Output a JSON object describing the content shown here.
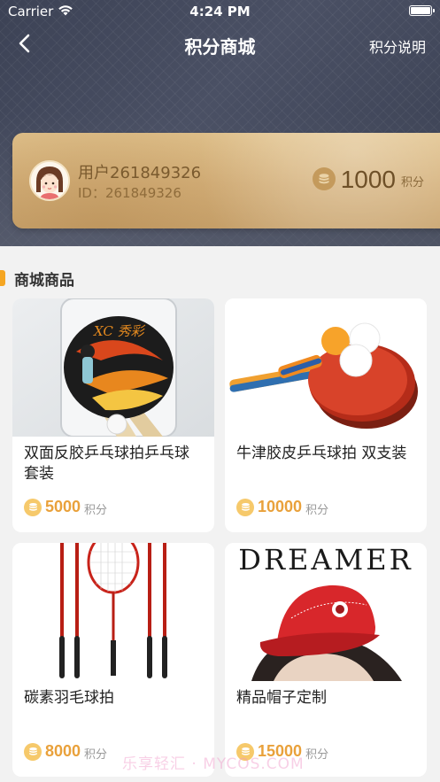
{
  "status_bar": {
    "carrier": "Carrier",
    "time": "4:24 PM"
  },
  "nav": {
    "title": "积分商城",
    "explain_label": "积分说明"
  },
  "user": {
    "name": "用户261849326",
    "id_text": "ID：261849326",
    "points": "1000",
    "points_unit": "积分"
  },
  "section": {
    "title": "商城商品"
  },
  "products": [
    {
      "name": "双面反胶乒乓球拍乒乓球套装",
      "price": "5000",
      "unit": "积分",
      "image_brand": "XC 秀彩"
    },
    {
      "name": "牛津胶皮乒乓球拍 双支装",
      "price": "10000",
      "unit": "积分"
    },
    {
      "name": "碳素羽毛球拍",
      "price": "8000",
      "unit": "积分"
    },
    {
      "name": "精品帽子定制",
      "price": "15000",
      "unit": "积分",
      "image_text": "DREAMER"
    }
  ],
  "watermark": "乐享轻汇 · MYCOS.COM",
  "colors": {
    "accent": "#f5a623",
    "price": "#e9a13b",
    "gold_card": "#d4b07a",
    "header": "#454b5e"
  }
}
